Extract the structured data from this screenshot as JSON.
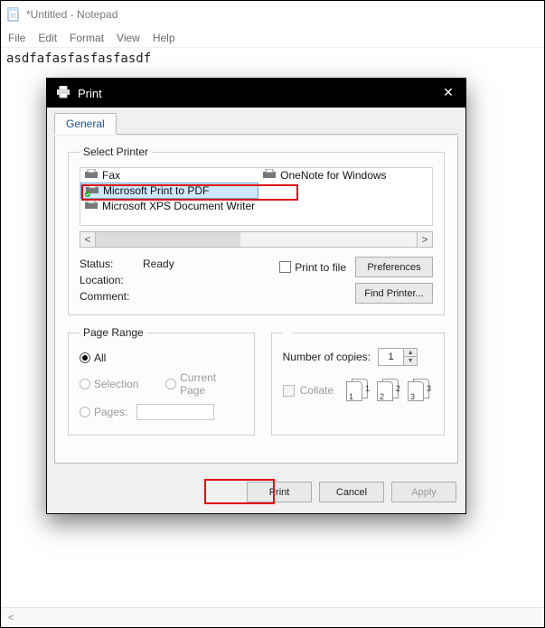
{
  "notepad": {
    "title": "*Untitled - Notepad",
    "menus": {
      "file": "File",
      "edit": "Edit",
      "format": "Format",
      "view": "View",
      "help": "Help"
    },
    "content": "asdfafasfasfasfasdf"
  },
  "dialog": {
    "title": "Print",
    "tab_general": "General",
    "group_select_printer": "Select Printer",
    "printers": [
      {
        "name": "Fax"
      },
      {
        "name": "OneNote for Windows"
      },
      {
        "name": "Microsoft Print to PDF"
      },
      {
        "name": "Microsoft XPS Document Writer"
      }
    ],
    "selected_printer_index": 2,
    "status_label": "Status:",
    "status_value": "Ready",
    "location_label": "Location:",
    "location_value": "",
    "comment_label": "Comment:",
    "comment_value": "",
    "print_to_file": "Print to file",
    "btn_preferences": "Preferences",
    "btn_find_printer": "Find Printer...",
    "group_page_range": "Page Range",
    "pr_all": "All",
    "pr_selection": "Selection",
    "pr_current": "Current Page",
    "pr_pages": "Pages:",
    "copies_label": "Number of copies:",
    "copies_value": "1",
    "collate_label": "Collate",
    "collate_graphic": [
      {
        "front": "1",
        "back": "1"
      },
      {
        "front": "2",
        "back": "2"
      },
      {
        "front": "3",
        "back": "3"
      }
    ],
    "btn_print": "Print",
    "btn_cancel": "Cancel",
    "btn_apply": "Apply"
  }
}
